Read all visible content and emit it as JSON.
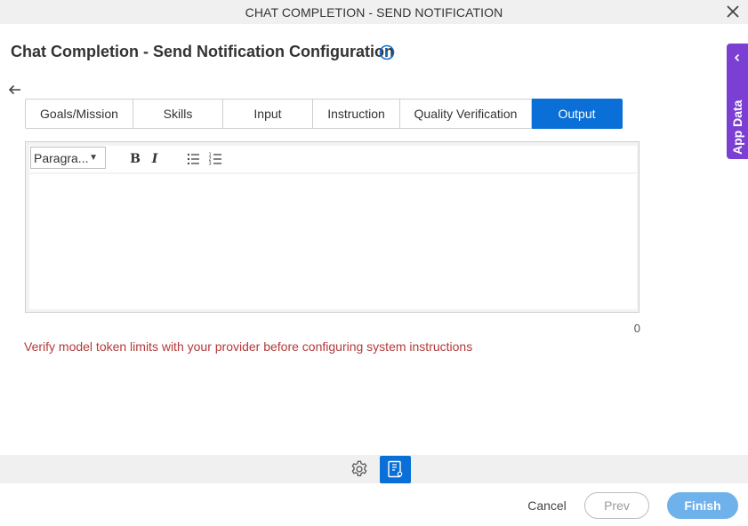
{
  "window": {
    "title": "CHAT COMPLETION - SEND NOTIFICATION",
    "close_icon": "close-icon"
  },
  "header": {
    "title": "Chat Completion - Send Notification Configuration",
    "info_icon": "info-icon",
    "back_icon": "arrow-left-icon"
  },
  "tabs": [
    {
      "label": "Goals/Mission",
      "active": false
    },
    {
      "label": "Skills",
      "active": false
    },
    {
      "label": "Input",
      "active": false
    },
    {
      "label": "Instruction",
      "active": false
    },
    {
      "label": "Quality Verification",
      "active": false
    },
    {
      "label": "Output",
      "active": true
    }
  ],
  "editor": {
    "format_select": "Paragra...",
    "bold_label": "B",
    "italic_label": "I",
    "bullet_list_icon": "bulleted-list-icon",
    "numbered_list_icon": "numbered-list-icon",
    "content": "",
    "char_count": "0"
  },
  "warning": "Verify model token limits with your provider before configuring system instructions",
  "app_data": {
    "label": "App Data",
    "icon": "chevron-left-icon"
  },
  "bottom_toolbar": {
    "settings_icon": "gear-icon",
    "document_icon": "document-icon"
  },
  "footer": {
    "cancel_label": "Cancel",
    "prev_label": "Prev",
    "finish_label": "Finish"
  },
  "colors": {
    "accent": "#0a6fd6",
    "app_data": "#7b3fd4",
    "warning": "#b33a3a",
    "finish_disabled": "#6fb1ea"
  }
}
